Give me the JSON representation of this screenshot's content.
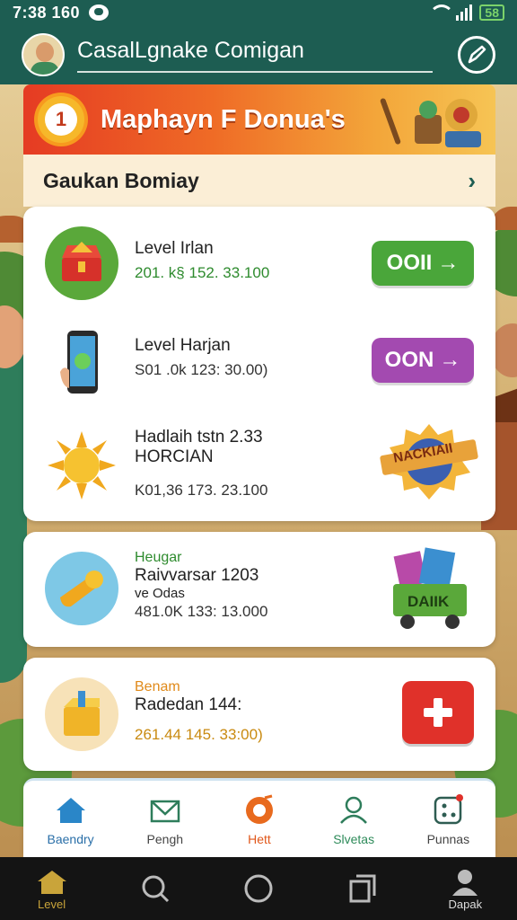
{
  "status_bar": {
    "time": "7:38 160",
    "battery": "58"
  },
  "header": {
    "title": "CasalLgnake Comigan"
  },
  "banner": {
    "badge": "1",
    "title": "Maphayn F Donua's"
  },
  "section": {
    "title": "Gaukan Bomiay"
  },
  "items": [
    {
      "line1": "Level Irlan",
      "line2": "201. k§ 152. 33.100",
      "line2_color": "#2e8b2e",
      "button": "OOII",
      "button_color": "#4aa63a",
      "icon": "treasure-chest-icon"
    },
    {
      "line1": "Level Harjan",
      "line2": "S01 .0k 123: 30.00)",
      "line2_color": "#333333",
      "button": "OON",
      "button_color": "#a34ab0",
      "icon": "smartphone-icon"
    },
    {
      "line1": "Hadlaih tstn   2.33",
      "line1b": "HORCIAN",
      "line2": "K01,36 173. 23.100",
      "line2_color": "#333333",
      "badge_label": "NACKIAII",
      "icon": "sun-icon"
    },
    {
      "tag": "Heugar",
      "tag_color": "#2e8b2e",
      "line1": "Raivvarsar     1203",
      "line1b": "ve Odas",
      "line2": "481.0K 133: 13.000",
      "line2_color": "#333333",
      "badge_label": "DAIIK",
      "icon": "horn-icon"
    },
    {
      "tag": "Benam",
      "tag_color": "#e08a1a",
      "line1": "Radedan     144:",
      "line2": "261.44 145. 33:00)",
      "line2_color": "#c98a10",
      "icon": "gift-box-icon"
    }
  ],
  "tabs": [
    {
      "label": "Baendry",
      "color": "#2a6fa8"
    },
    {
      "label": "Pengh",
      "color": "#444444"
    },
    {
      "label": "Hett",
      "color": "#e0571a"
    },
    {
      "label": "Slvetas",
      "color": "#2e8b5a"
    },
    {
      "label": "Punnas",
      "color": "#444444"
    }
  ],
  "navbar": {
    "home_label": "Level",
    "account_label": "Dapak"
  }
}
